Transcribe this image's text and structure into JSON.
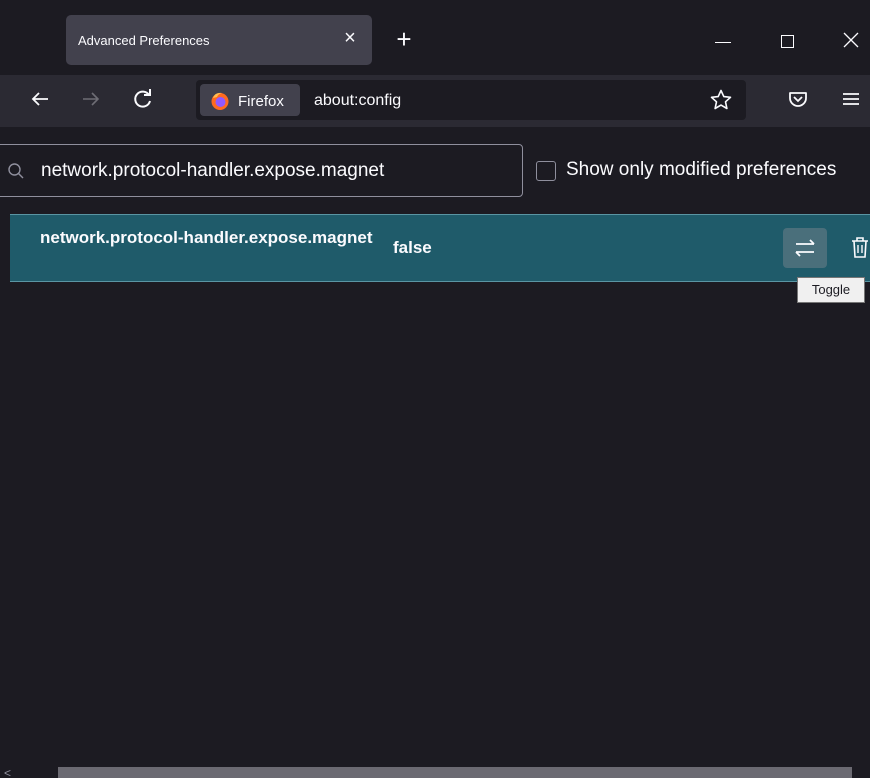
{
  "tab": {
    "title": "Advanced Preferences",
    "close_glyph": "×"
  },
  "new_tab_glyph": "+",
  "navbar": {
    "identity_label": "Firefox",
    "url": "about:config"
  },
  "search": {
    "value": "network.protocol-handler.expose.magnet",
    "placeholder": "Search preference name"
  },
  "filter": {
    "label": "Show only modified preferences",
    "checked": false
  },
  "preference": {
    "name": "network.protocol-handler.expose.magnet",
    "value": "false"
  },
  "tooltip": {
    "text": "Toggle"
  },
  "colors": {
    "background": "#1c1b22",
    "toolbar": "#2b2a33",
    "row_highlight": "#1f5b6a",
    "text": "#fbfbfe"
  },
  "icons": [
    "close-icon",
    "plus-icon",
    "minimize-icon",
    "maximize-icon",
    "window-close-icon",
    "back-arrow-icon",
    "forward-arrow-icon",
    "reload-icon",
    "firefox-logo-icon",
    "star-icon",
    "pocket-icon",
    "menu-icon",
    "search-icon",
    "toggle-icon",
    "trash-icon"
  ]
}
